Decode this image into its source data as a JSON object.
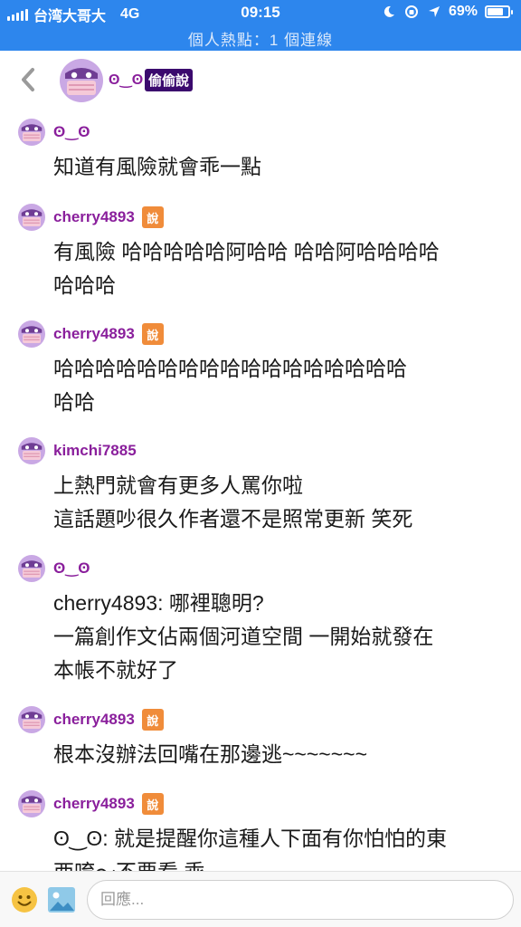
{
  "status_bar": {
    "carrier": "台湾大哥大",
    "network": "4G",
    "time": "09:15",
    "battery": "69%",
    "subtitle": "個人熱點：1 個連線"
  },
  "header": {
    "name": "ʘ‿ʘ",
    "tag": "偷偷說"
  },
  "messages": [
    {
      "author": "ʘ‿ʘ",
      "say_badge": "",
      "text": "知道有風險就會乖一點"
    },
    {
      "author": "cherry4893",
      "say_badge": "說",
      "text": "有風險 哈哈哈哈哈阿哈哈 哈哈阿哈哈哈哈\n哈哈哈"
    },
    {
      "author": "cherry4893",
      "say_badge": "說",
      "text": "哈哈哈哈哈哈哈哈哈哈哈哈哈哈哈哈哈\n哈哈"
    },
    {
      "author": "kimchi7885",
      "say_badge": "",
      "text": "上熱門就會有更多人罵你啦\n這話題吵很久作者還不是照常更新 笑死"
    },
    {
      "author": "ʘ‿ʘ",
      "say_badge": "",
      "text": "cherry4893: 哪裡聰明?\n一篇創作文佔兩個河道空間 一開始就發在\n本帳不就好了"
    },
    {
      "author": "cherry4893",
      "say_badge": "說",
      "text": "根本沒辦法回嘴在那邊逃~~~~~~~"
    },
    {
      "author": "cherry4893",
      "say_badge": "說",
      "text": "ʘ‿ʘ: 就是提醒你這種人下面有你怕怕的東\n西唷～不要看 乖"
    }
  ],
  "composer": {
    "placeholder": "回應..."
  },
  "colors": {
    "status_bar": "#2d86ed",
    "username": "#8a1f9c",
    "tag_bg": "#3b0a6e",
    "say_badge": "#f08c3a"
  }
}
